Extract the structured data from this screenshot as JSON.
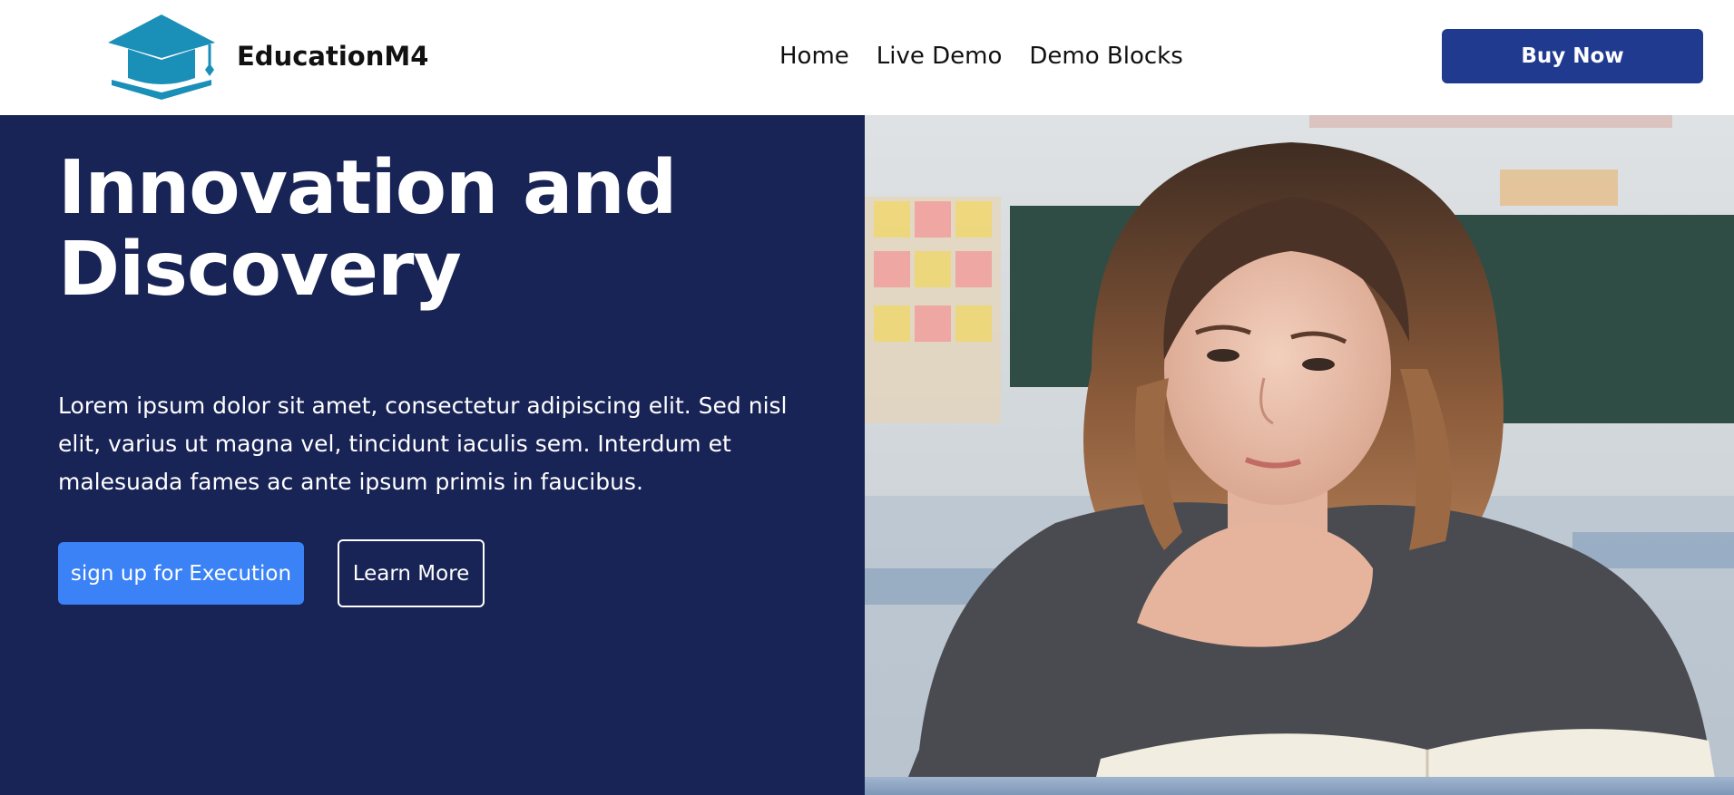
{
  "header": {
    "brand_name": "EducationM4",
    "logo_icon": "graduation-cap-icon",
    "nav": [
      {
        "label": "Home"
      },
      {
        "label": "Live Demo"
      },
      {
        "label": "Demo Blocks"
      }
    ],
    "buy_button_label": "Buy Now"
  },
  "hero": {
    "title_line1": "Innovation and",
    "title_line2": "Discovery",
    "description": "Lorem ipsum dolor sit amet, consectetur adipiscing elit. Sed nisl elit, varius ut magna vel, tincidunt iaculis sem. Interdum et malesuada fames ac ante ipsum primis in faucibus.",
    "primary_button_label": "sign up for Execution",
    "secondary_button_label": "Learn More"
  },
  "colors": {
    "hero_background": "#182356",
    "buy_button": "#1f3a8f",
    "primary_button": "#3b82f6",
    "logo": "#1a8fb8"
  }
}
